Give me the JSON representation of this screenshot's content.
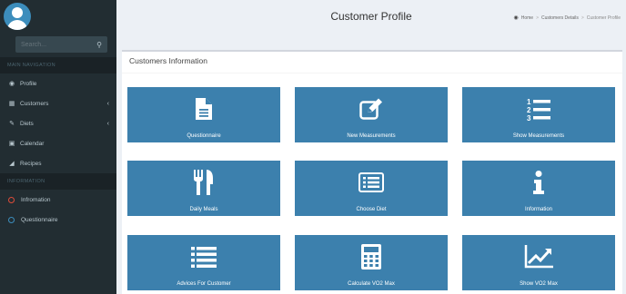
{
  "sidebar": {
    "search_placeholder": "Search...",
    "main_header": "MAIN NAVIGATION",
    "info_header": "INFORMATION",
    "main_items": [
      {
        "label": "Profile",
        "icon": "dashboard-icon",
        "glyph": "◉"
      },
      {
        "label": "Customers",
        "icon": "table-icon",
        "glyph": "▦",
        "chevron": "‹"
      },
      {
        "label": "Diets",
        "icon": "edit-icon",
        "glyph": "✎",
        "chevron": "‹"
      },
      {
        "label": "Calendar",
        "icon": "calendar-icon",
        "glyph": "▣"
      },
      {
        "label": "Recipes",
        "icon": "book-icon",
        "glyph": "◢"
      }
    ],
    "info_items": [
      {
        "label": "Infromation",
        "color": "#dd4b39"
      },
      {
        "label": "Questionnaire",
        "color": "#3c8dbc"
      }
    ]
  },
  "header": {
    "title": "Customer Profile",
    "breadcrumb": [
      "Home",
      "Customers Details",
      "Customer Profile"
    ]
  },
  "box": {
    "title": "Customers Information"
  },
  "tiles": [
    {
      "label": "Questionnaire",
      "icon": "file-icon"
    },
    {
      "label": "New Measurements",
      "icon": "edit-icon"
    },
    {
      "label": "Show Measurements",
      "icon": "list-ol-icon"
    },
    {
      "label": "Daily Meals",
      "icon": "cutlery-icon"
    },
    {
      "label": "Choose Diet",
      "icon": "list-alt-icon"
    },
    {
      "label": "Information",
      "icon": "info-icon"
    },
    {
      "label": "Advices For Customer",
      "icon": "list-icon"
    },
    {
      "label": "Calculate VO2 Max",
      "icon": "calculator-icon"
    },
    {
      "label": "Show VO2 Max",
      "icon": "line-chart-icon"
    }
  ],
  "colors": {
    "sidebar": "#222d32",
    "tile": "#3c80ad",
    "accent": "#3c8dbc"
  }
}
